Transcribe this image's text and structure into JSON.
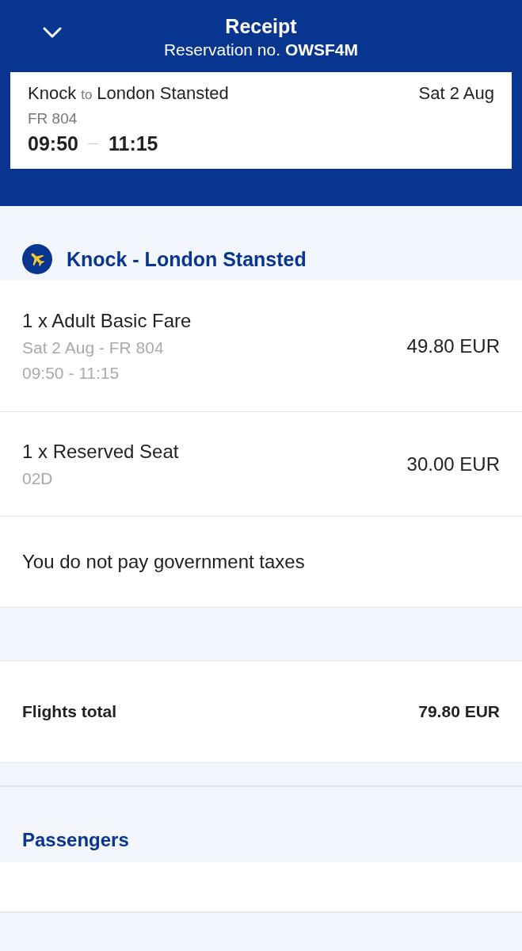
{
  "header": {
    "title": "Receipt",
    "reservation": "Reservation no. **OWSF4M**"
  },
  "flight_card": {
    "origin": "Knock",
    "connector": "to",
    "destination": "London Stansted",
    "date": "Sat 2 Aug",
    "flight_no": "FR 804",
    "departure": "09:50",
    "arrival": "11:15"
  },
  "section": {
    "title": "Knock - London Stansted",
    "items": [
      {
        "kind": "priced",
        "label": "1 x Adult Basic Fare",
        "details": [
          "Sat 2 Aug - FR 804",
          "09:50 - 11:15"
        ],
        "price": "49.80 EUR"
      },
      {
        "kind": "priced",
        "label": "1 x Reserved Seat",
        "details": [
          "02D"
        ],
        "price": "30.00 EUR"
      },
      {
        "kind": "note",
        "label": "You do not pay government taxes"
      }
    ]
  },
  "total": {
    "label": "Flights total",
    "amount": "79.80 EUR"
  },
  "passengers": {
    "title": "Passengers"
  }
}
